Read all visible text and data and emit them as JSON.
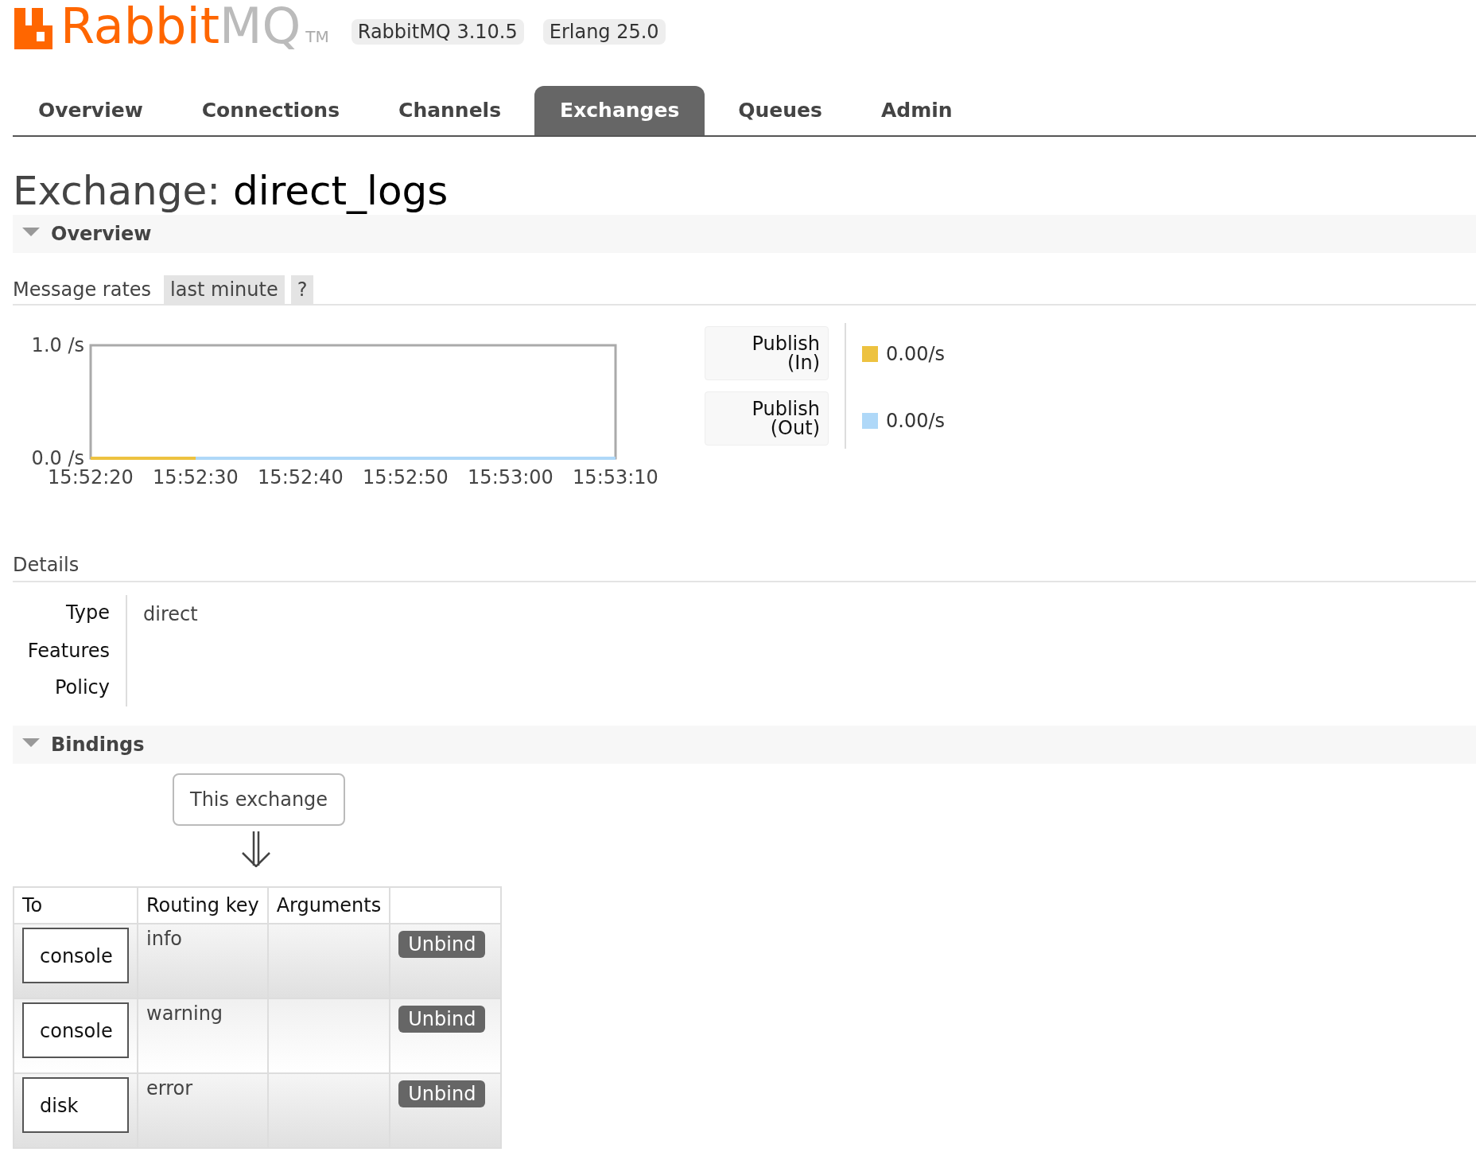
{
  "logo": {
    "primary": "Rabbit",
    "secondary": "MQ",
    "trademark": "TM"
  },
  "versions": [
    "RabbitMQ 3.10.5",
    "Erlang 25.0"
  ],
  "tabs": [
    {
      "label": "Overview",
      "selected": false
    },
    {
      "label": "Connections",
      "selected": false
    },
    {
      "label": "Channels",
      "selected": false
    },
    {
      "label": "Exchanges",
      "selected": true
    },
    {
      "label": "Queues",
      "selected": false
    },
    {
      "label": "Admin",
      "selected": false
    }
  ],
  "title": {
    "prefix": "Exchange:",
    "name": "direct_logs"
  },
  "overview": {
    "heading": "Overview",
    "expanded": true,
    "message_rates": {
      "label": "Message rates",
      "period": "last minute",
      "help": "?"
    },
    "chart_data": {
      "type": "line",
      "categories": [
        "15:52:20",
        "15:52:30",
        "15:52:40",
        "15:52:50",
        "15:53:00",
        "15:53:10"
      ],
      "ylim": [
        0,
        1
      ],
      "yticks": [
        {
          "value": 0,
          "label": "0.0 /s"
        },
        {
          "value": 1,
          "label": "1.0 /s"
        }
      ],
      "series": [
        {
          "name": "Publish (In)",
          "color": "#edc240",
          "values": [
            0,
            0,
            null,
            null,
            null,
            null
          ]
        },
        {
          "name": "Publish (Out)",
          "color": "#afd8f8",
          "values": [
            null,
            0,
            0,
            0,
            0,
            0
          ]
        }
      ]
    },
    "rates": [
      "0.00/s",
      "0.00/s"
    ]
  },
  "details": {
    "heading": "Details",
    "rows": [
      {
        "label": "Type",
        "value": "direct"
      },
      {
        "label": "Features"
      },
      {
        "label": "Policy"
      }
    ]
  },
  "bindings": {
    "heading": "Bindings",
    "expanded": true,
    "source": "This exchange",
    "columns": [
      "To",
      "Routing key",
      "Arguments"
    ],
    "rows": [
      {
        "to": "console",
        "routing_key": "info",
        "action": "Unbind"
      },
      {
        "to": "console",
        "routing_key": "warning",
        "action": "Unbind"
      },
      {
        "to": "disk",
        "routing_key": "error",
        "action": "Unbind"
      }
    ]
  }
}
